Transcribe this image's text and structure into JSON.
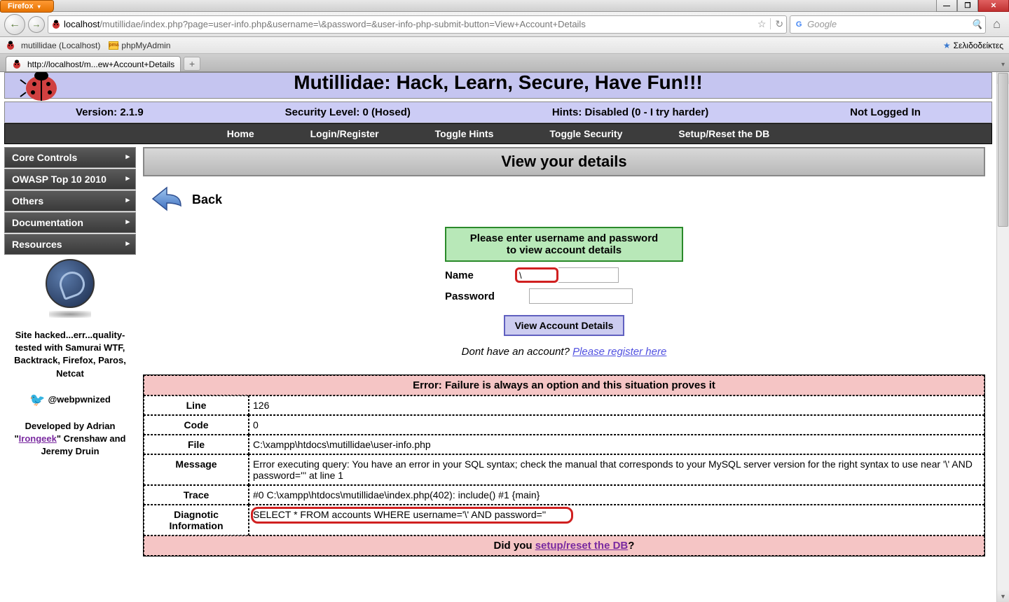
{
  "app": {
    "name": "Firefox"
  },
  "window_controls": {
    "min": "—",
    "max": "❐",
    "close": "✕"
  },
  "urlbar": {
    "host": "localhost",
    "path": "/mutillidae/index.php?page=user-info.php&username=\\&password=&user-info-php-submit-button=View+Account+Details",
    "reload": "↻"
  },
  "searchbox": {
    "placeholder": "Google"
  },
  "bookmarks": {
    "b1": "mutillidae (Localhost)",
    "b2": "phpMyAdmin",
    "right": "Σελιδοδείκτες"
  },
  "tabs": {
    "t1": "http://localhost/m...ew+Account+Details"
  },
  "mut": {
    "title": "Mutillidae: Hack, Learn, Secure, Have Fun!!!",
    "info": {
      "version": "Version: 2.1.9",
      "sec": "Security Level: 0 (Hosed)",
      "hints": "Hints: Disabled (0 - I try harder)",
      "login": "Not Logged In"
    },
    "nav": {
      "home": "Home",
      "login": "Login/Register",
      "hints": "Toggle Hints",
      "tsec": "Toggle Security",
      "setup": "Setup/Reset the DB"
    },
    "side": {
      "core": "Core Controls",
      "owasp": "OWASP Top 10 2010",
      "others": "Others",
      "docs": "Documentation",
      "res": "Resources",
      "text1": "Site hacked...err...quality-tested with Samurai WTF, Backtrack, Firefox, Paros, Netcat",
      "twit": "@webpwnized",
      "dev1": "Developed by Adrian \"",
      "irongeek": "Irongeek",
      "dev2": "\" Crenshaw and Jeremy Druin"
    },
    "page": {
      "title": "View your details",
      "back": "Back",
      "form_head": "Please enter username and password\nto view account details",
      "name_lbl": "Name",
      "name_val": "\\",
      "pass_lbl": "Password",
      "btn": "View Account Details",
      "reg1": "Dont have an account? ",
      "reg2": "Please register here"
    },
    "err": {
      "head": "Error: Failure is always an option and this situation proves it",
      "line_k": "Line",
      "line_v": "126",
      "code_k": "Code",
      "code_v": "0",
      "file_k": "File",
      "file_v": "C:\\xampp\\htdocs\\mutillidae\\user-info.php",
      "msg_k": "Message",
      "msg_v": "Error executing query: You have an error in your SQL syntax; check the manual that corresponds to your MySQL server version for the right syntax to use near '\\' AND password=''' at line 1",
      "trace_k": "Trace",
      "trace_v": "#0 C:\\xampp\\htdocs\\mutillidae\\index.php(402): include() #1 {main}",
      "diag_k": "Diagnotic Information",
      "diag_v": "SELECT * FROM accounts WHERE username='\\' AND password=''",
      "foot1": "Did you ",
      "foot_link": "setup/reset the DB",
      "foot2": "?"
    }
  }
}
